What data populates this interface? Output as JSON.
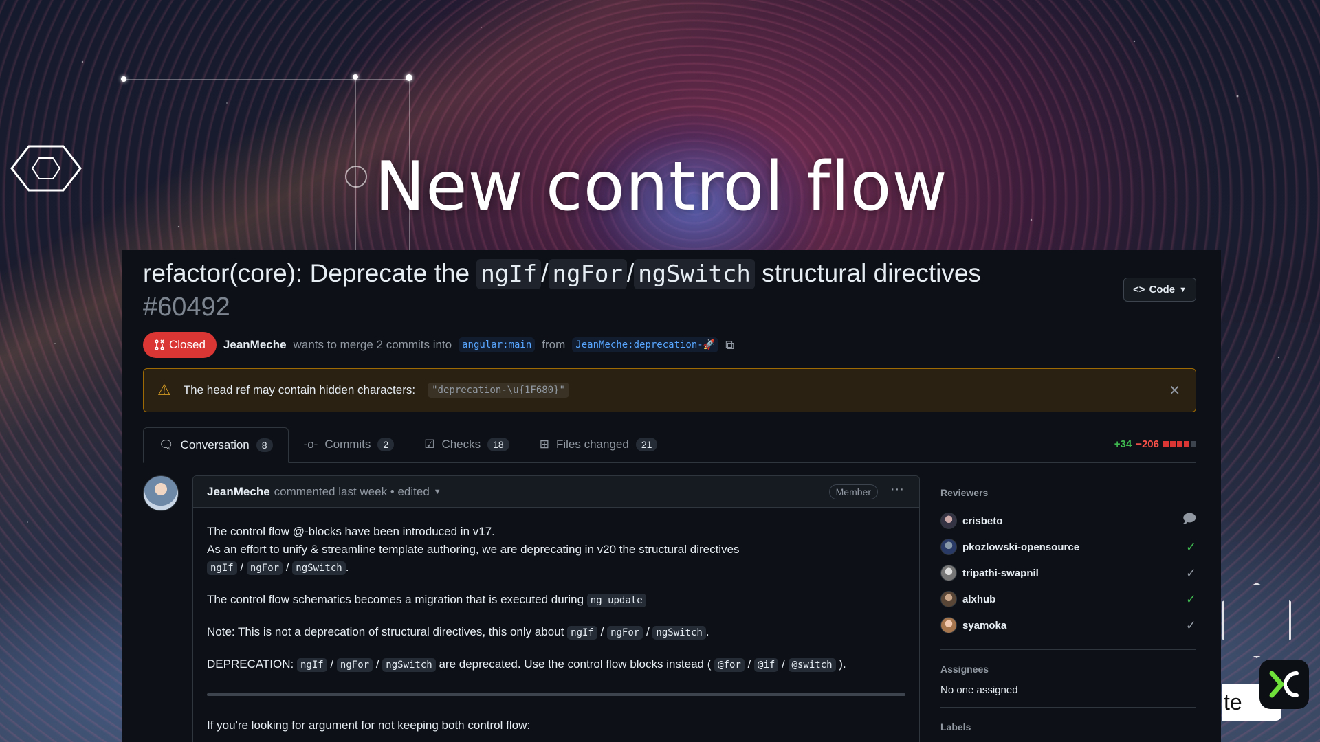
{
  "slide": {
    "title": "New control flow"
  },
  "pr": {
    "title_prefix": "refactor(core): Deprecate the ",
    "title_code_1": "ngIf",
    "title_sep_1": "/",
    "title_code_2": "ngFor",
    "title_sep_2": "/",
    "title_code_3": "ngSwitch",
    "title_suffix": " structural directives",
    "number": "#60492",
    "code_button": "Code",
    "status": "Closed",
    "author": "JeanMeche",
    "merge_text": "wants to merge 2 commits into",
    "base_branch": "angular:main",
    "from_text": "from",
    "head_branch": "JeanMeche:deprecation-🚀"
  },
  "warning": {
    "text": "The head ref may contain hidden characters:",
    "ref": "\"deprecation-\\u{1F680}\""
  },
  "tabs": [
    {
      "label": "Conversation",
      "count": "8",
      "icon": "comment-discussion-icon"
    },
    {
      "label": "Commits",
      "count": "2",
      "icon": "git-commit-icon"
    },
    {
      "label": "Checks",
      "count": "18",
      "icon": "checklist-icon"
    },
    {
      "label": "Files changed",
      "count": "21",
      "icon": "file-diff-icon"
    }
  ],
  "diffstat": {
    "additions": "+34",
    "deletions": "−206"
  },
  "comment": {
    "author": "JeanMeche",
    "meta": "commented last week • edited",
    "badge": "Member",
    "p1_line1": "The control flow @-blocks have been introduced in v17.",
    "p1_line2": "As an effort to unify & streamline template authoring, we are deprecating in v20 the structural directives",
    "code_ngIf": "ngIf",
    "code_ngFor": "ngFor",
    "code_ngSwitch": "ngSwitch",
    "slash": "/",
    "period": ".",
    "p2_text": "The control flow schematics becomes a migration that is executed during",
    "p2_code": "ng update",
    "p3_text": "Note: This is not a deprecation of structural directives, this only about",
    "p4_prefix": "DEPRECATION:",
    "p4_middle": "are deprecated. Use the control flow blocks instead (",
    "code_for": "@for",
    "code_if": "@if",
    "code_switch": "@switch",
    "p4_suffix": ").",
    "p5": "If you're looking for argument for not keeping both control flow:"
  },
  "sidebar": {
    "reviewers_heading": "Reviewers",
    "reviewers": [
      {
        "name": "crisbeto",
        "status": "commented"
      },
      {
        "name": "pkozlowski-opensource",
        "status": "approved"
      },
      {
        "name": "tripathi-swapnil",
        "status": "reviewed"
      },
      {
        "name": "alxhub",
        "status": "approved"
      },
      {
        "name": "syamoka",
        "status": "reviewed"
      }
    ],
    "assignees_heading": "Assignees",
    "assignees_value": "No one assigned",
    "labels_heading": "Labels"
  },
  "overlay": {
    "cta_text": "te"
  },
  "colors": {
    "closed": "#da3633",
    "approved": "#3fb950",
    "link": "#58a6ff",
    "warning_border": "#9e6a03"
  }
}
